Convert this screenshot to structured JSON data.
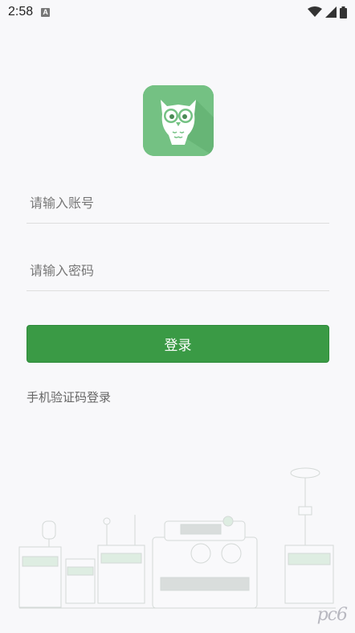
{
  "status_bar": {
    "time": "2:58",
    "notification_icon": "A",
    "icons": [
      "wifi-icon",
      "cell-signal-icon",
      "battery-icon"
    ]
  },
  "logo": {
    "icon": "owl-logo",
    "color": "#74c183"
  },
  "form": {
    "account_placeholder": "请输入账号",
    "password_placeholder": "请输入密码",
    "login_label": "登录",
    "sms_login_label": "手机验证码登录"
  },
  "colors": {
    "primary": "#3a9a45",
    "background": "#f8f8fa"
  },
  "watermark": "pc6"
}
